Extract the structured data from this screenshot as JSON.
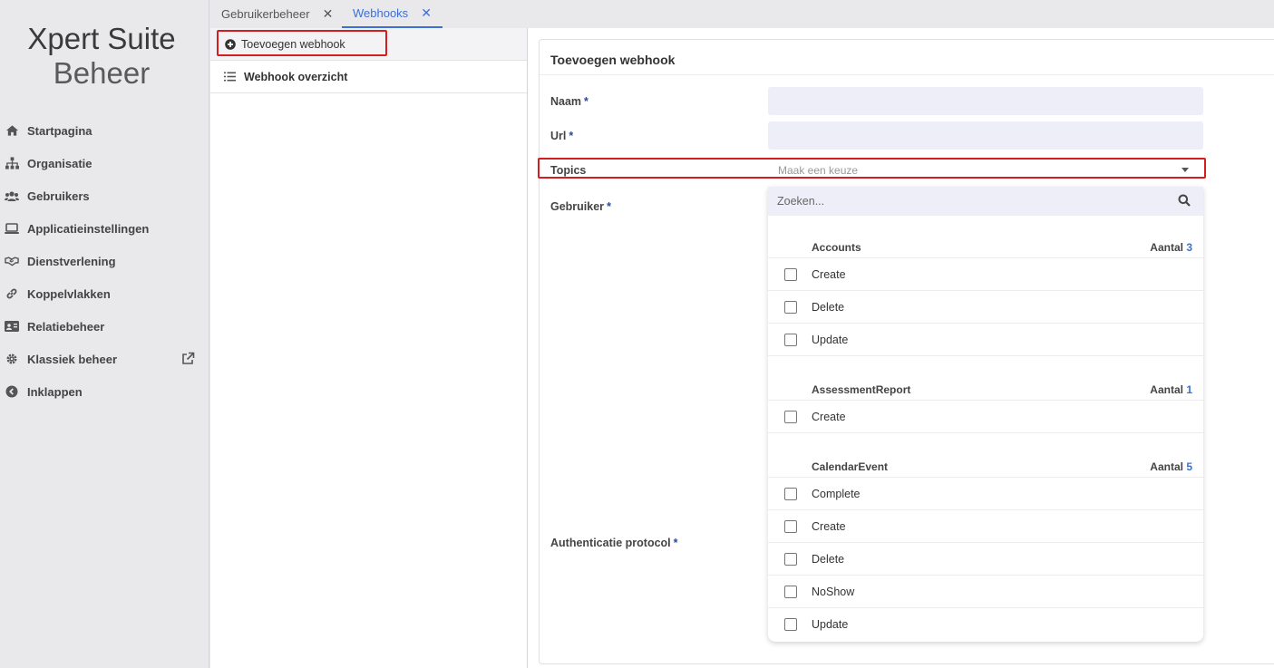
{
  "sidebar": {
    "logo_line1": "Xpert Suite",
    "logo_line2": "Beheer",
    "items": [
      {
        "label": "Startpagina",
        "icon": "home-icon"
      },
      {
        "label": "Organisatie",
        "icon": "sitemap-icon"
      },
      {
        "label": "Gebruikers",
        "icon": "users-icon"
      },
      {
        "label": "Applicatieinstellingen",
        "icon": "laptop-icon"
      },
      {
        "label": "Dienstverlening",
        "icon": "handshake-icon"
      },
      {
        "label": "Koppelvlakken",
        "icon": "link-icon"
      },
      {
        "label": "Relatiebeheer",
        "icon": "id-card-icon"
      },
      {
        "label": "Klassiek beheer",
        "icon": "gear-icon"
      },
      {
        "label": "Inklappen",
        "icon": "chevron-left-circle-icon"
      }
    ]
  },
  "tabs": [
    {
      "label": "Gebruikerbeheer",
      "close": "✕",
      "active": false
    },
    {
      "label": "Webhooks",
      "close": "✕",
      "active": true
    }
  ],
  "midpanel": {
    "add_label": "Toevoegen webhook",
    "overview_label": "Webhook overzicht"
  },
  "form": {
    "title": "Toevoegen webhook",
    "required_mark": "*",
    "naam_label": "Naam",
    "url_label": "Url",
    "topics_label": "Topics",
    "topics_placeholder": "Maak een keuze",
    "gebruiker_label": "Gebruiker",
    "auth_label": "Authenticatie protocol"
  },
  "dropdown": {
    "search_placeholder": "Zoeken...",
    "count_label": "Aantal",
    "groups": [
      {
        "name": "Accounts",
        "count": "3",
        "options": [
          "Create",
          "Delete",
          "Update"
        ]
      },
      {
        "name": "AssessmentReport",
        "count": "1",
        "options": [
          "Create"
        ]
      },
      {
        "name": "CalendarEvent",
        "count": "5",
        "options": [
          "Complete",
          "Create",
          "Delete",
          "NoShow",
          "Update"
        ]
      }
    ]
  },
  "colors": {
    "accent": "#3b6fd6",
    "highlight": "#d51f1f",
    "input_bg": "#eeeef8"
  }
}
